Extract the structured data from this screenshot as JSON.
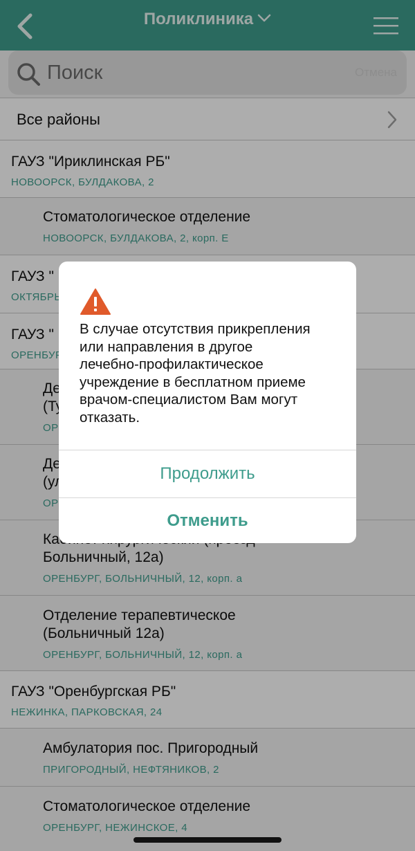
{
  "header": {
    "title": "Поликлиника"
  },
  "search": {
    "placeholder": "Поиск",
    "cancel_label": "Отмена"
  },
  "district": {
    "label": "Все районы"
  },
  "list": [
    {
      "kind": "group",
      "title": "ГАУЗ \"Ириклинская РБ\"",
      "address": "НОВООРСК, БУЛДАКОВА, 2"
    },
    {
      "kind": "sub",
      "title": "Стоматологическое отделение",
      "address": "НОВООРСК, БУЛДАКОВА, 2, корп. Е"
    },
    {
      "kind": "group",
      "title": "ГАУЗ \"",
      "address": "ОКТЯБРЬ"
    },
    {
      "kind": "group",
      "title": "ГАУЗ \"",
      "address": "ОРЕНБУР"
    },
    {
      "kind": "sub",
      "title": "Де",
      "title2": "(Ту",
      "address": "ОР"
    },
    {
      "kind": "sub",
      "title": "Де",
      "title2": "(ул",
      "address": "ОР"
    },
    {
      "kind": "sub",
      "title": "Кабинет хирургический (проезд",
      "title2": "Больничный, 12а)",
      "address": "ОРЕНБУРГ, БОЛЬНИЧНЫЙ, 12, корп. а"
    },
    {
      "kind": "sub",
      "title": "Отделение терапевтическое",
      "title2": "(Больничный 12а)",
      "address": "ОРЕНБУРГ, БОЛЬНИЧНЫЙ, 12, корп. а"
    },
    {
      "kind": "group",
      "title": "ГАУЗ \"Оренбургская РБ\"",
      "address": "НЕЖИНКА, ПАРКОВСКАЯ, 24"
    },
    {
      "kind": "sub",
      "title": "Амбулатория пос. Пригородный",
      "address": "ПРИГОРОДНЫЙ, НЕФТЯНИКОВ, 2"
    },
    {
      "kind": "sub",
      "title": "Стоматологическое отделение",
      "address": "ОРЕНБУРГ, НЕЖИНСКОЕ, 4"
    }
  ],
  "dialog": {
    "message_lines": [
      "В случае отсутствия прикрепления",
      "или направления в другое",
      "лечебно-профилактическое",
      "учреждение в бесплатном приеме",
      "врачом-специалистом Вам могут",
      "отказать."
    ],
    "continue_label": "Продолжить",
    "cancel_label": "Отменить"
  },
  "colors": {
    "accent": "#3e9c8c",
    "warning": "#e05a2b"
  },
  "icons": {
    "back": "chevron-left-icon",
    "menu": "hamburger-menu-icon",
    "search": "search-icon",
    "warning": "warning-triangle-icon",
    "disclosure": "chevron-right-icon",
    "title": "chevron-down-icon"
  }
}
